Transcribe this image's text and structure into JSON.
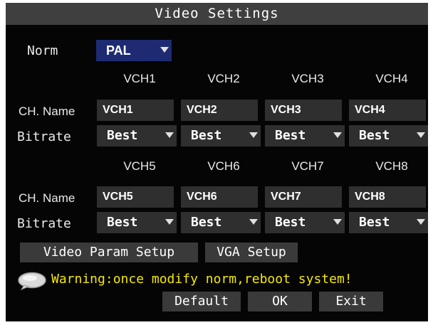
{
  "window": {
    "title": "Video Settings"
  },
  "norm": {
    "label": "Norm",
    "value": "PAL"
  },
  "row_labels": {
    "ch_name": "CH. Name",
    "bitrate": "Bitrate"
  },
  "groups": [
    {
      "headers": [
        "VCH1",
        "VCH2",
        "VCH3",
        "VCH4"
      ],
      "names": [
        "VCH1",
        "VCH2",
        "VCH3",
        "VCH4"
      ],
      "bitrates": [
        "Best",
        "Best",
        "Best",
        "Best"
      ]
    },
    {
      "headers": [
        "VCH5",
        "VCH6",
        "VCH7",
        "VCH8"
      ],
      "names": [
        "VCH5",
        "VCH6",
        "VCH7",
        "VCH8"
      ],
      "bitrates": [
        "Best",
        "Best",
        "Best",
        "Best"
      ]
    }
  ],
  "buttons": {
    "video_param_setup": "Video Param Setup",
    "vga_setup": "VGA Setup",
    "default": "Default",
    "ok": "OK",
    "exit": "Exit"
  },
  "warning": {
    "text": "Warning:once modify norm,reboot system!",
    "icon": "speech-bubble-icon"
  },
  "colors": {
    "title_bar": "#3f3f3f",
    "field_bg": "#2f2f2f",
    "norm_dropdown": "#1e2b73",
    "warning_text": "#f5e900",
    "panel_bg": "#050505"
  }
}
